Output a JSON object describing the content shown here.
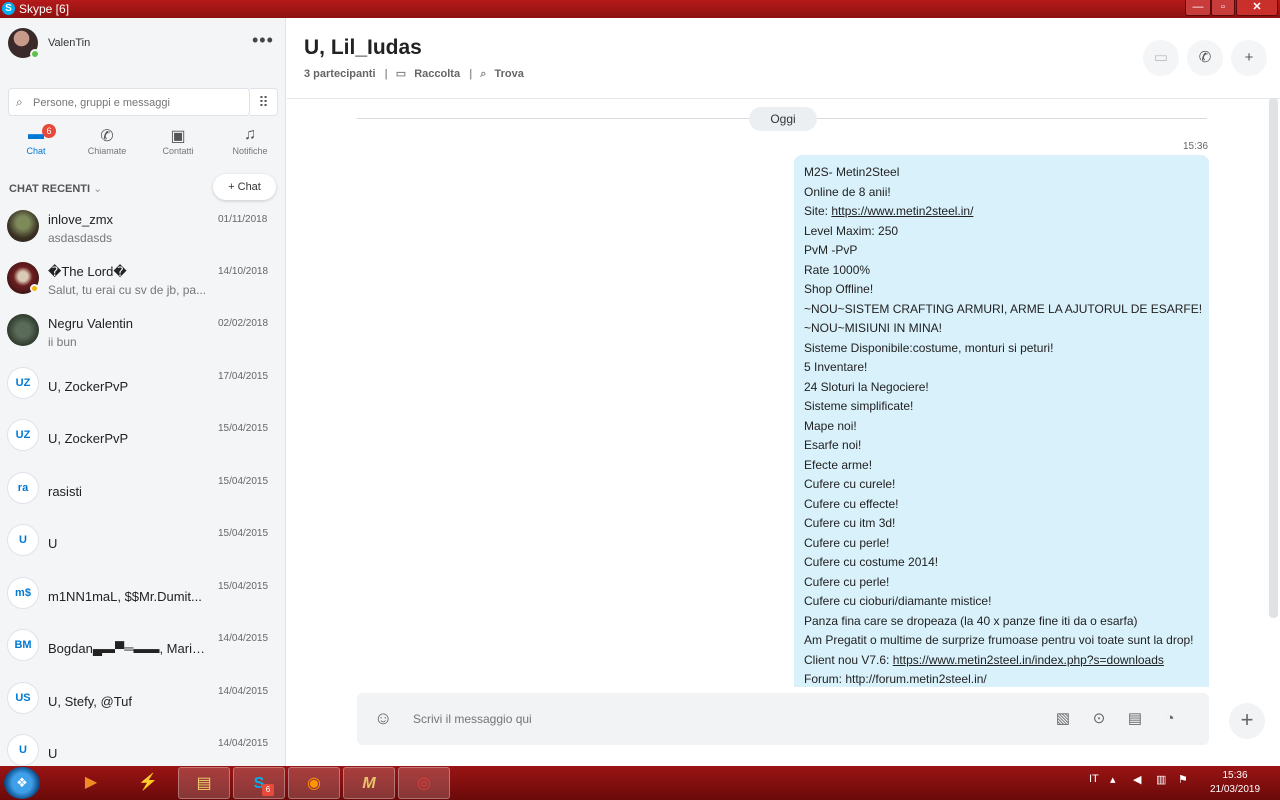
{
  "window": {
    "title": "Skype [6]",
    "minimize": "—",
    "maximize": "▫",
    "close": "✕"
  },
  "sidebar": {
    "profile_name": "ValenTin",
    "search_placeholder": "Persone, gruppi e messaggi",
    "tabs": [
      {
        "label": "Chat",
        "icon": "chat-icon",
        "badge": "6",
        "active": true
      },
      {
        "label": "Chiamate",
        "icon": "phone-icon"
      },
      {
        "label": "Contatti",
        "icon": "contacts-icon"
      },
      {
        "label": "Notifiche",
        "icon": "bell-icon"
      }
    ],
    "recent_label": "CHAT RECENTI",
    "new_chat_label": "Chat",
    "chats": [
      {
        "name": "inlove_zmx",
        "preview": "asdasdasds",
        "date": "01/11/2018"
      },
      {
        "name": "�The Lord�",
        "preview": "Salut, tu erai cu sv de jb, pa...",
        "date": "14/10/2018"
      },
      {
        "name": "Negru Valentin",
        "preview": "ii bun",
        "date": "02/02/2018"
      },
      {
        "initials": "UZ",
        "name": "U, ZockerPvP",
        "date": "17/04/2015"
      },
      {
        "initials": "UZ",
        "name": "U, ZockerPvP",
        "date": "15/04/2015"
      },
      {
        "initials": "ra",
        "name": "rasisti",
        "date": "15/04/2015"
      },
      {
        "initials": "U",
        "name": "U",
        "date": "15/04/2015"
      },
      {
        "initials": "m$",
        "name": "m1NN1maL, $$Mr.Dumit...",
        "date": "15/04/2015"
      },
      {
        "initials": "BM",
        "name": "Bogdan▄▬▀═▬▬, Maria...",
        "date": "14/04/2015"
      },
      {
        "initials": "US",
        "name": "U, Stefy, @Tuf",
        "date": "14/04/2015"
      },
      {
        "initials": "U",
        "name": "U",
        "date": "14/04/2015"
      }
    ]
  },
  "conversation": {
    "title": "U, Lil_Iudas",
    "participants": "3 partecipanti",
    "gallery": "Raccolta",
    "find": "Trova",
    "day_label": "Oggi",
    "time": "15:36",
    "message_lines": [
      "M2S- Metin2Steel",
      "Online de 8 anii!",
      "Site: ",
      "Level Maxim: 250",
      "PvM -PvP",
      "Rate 1000%",
      "Shop Offline!",
      "~NOU~SISTEM CRAFTING ARMURI, ARME LA AJUTORUL DE ESARFE!",
      "~NOU~MISIUNI IN MINA!",
      "Sisteme Disponibile:costume, monturi si peturi!",
      "5 Inventare!",
      "24 Sloturi la Negociere!",
      "Sisteme simplificate!",
      "Mape noi!",
      "Esarfe noi!",
      "Efecte arme!",
      "Cufere cu curele!",
      "Cufere cu effecte!",
      "Cufere cu itm 3d!",
      "Cufere cu perle!",
      "Cufere cu costume 2014!",
      "Cufere cu perle!",
      "Cufere cu cioburi/diamante mistice!",
      "Panza fina care se dropeaza (la 40 x panze fine iti da o esarfa)",
      "Am Pregatit o multime de surprize frumoase pentru voi toate sunt la drop!",
      "Client nou V7.6: ",
      "Forum: http://forum.metin2steel.in/"
    ],
    "site_link": "https://www.metin2steel.in/",
    "client_link": "https://www.metin2steel.in/index.php?s=downloads",
    "composer_placeholder": "Scrivi il messaggio qui"
  },
  "taskbar": {
    "lang": "IT",
    "time": "15:36",
    "date": "21/03/2019",
    "skype_badge": "6"
  },
  "colors": {
    "accent": "#0078d4",
    "bubble": "#d9f1fb",
    "taskbar": "#8d1010",
    "badge": "#e54a3b"
  }
}
